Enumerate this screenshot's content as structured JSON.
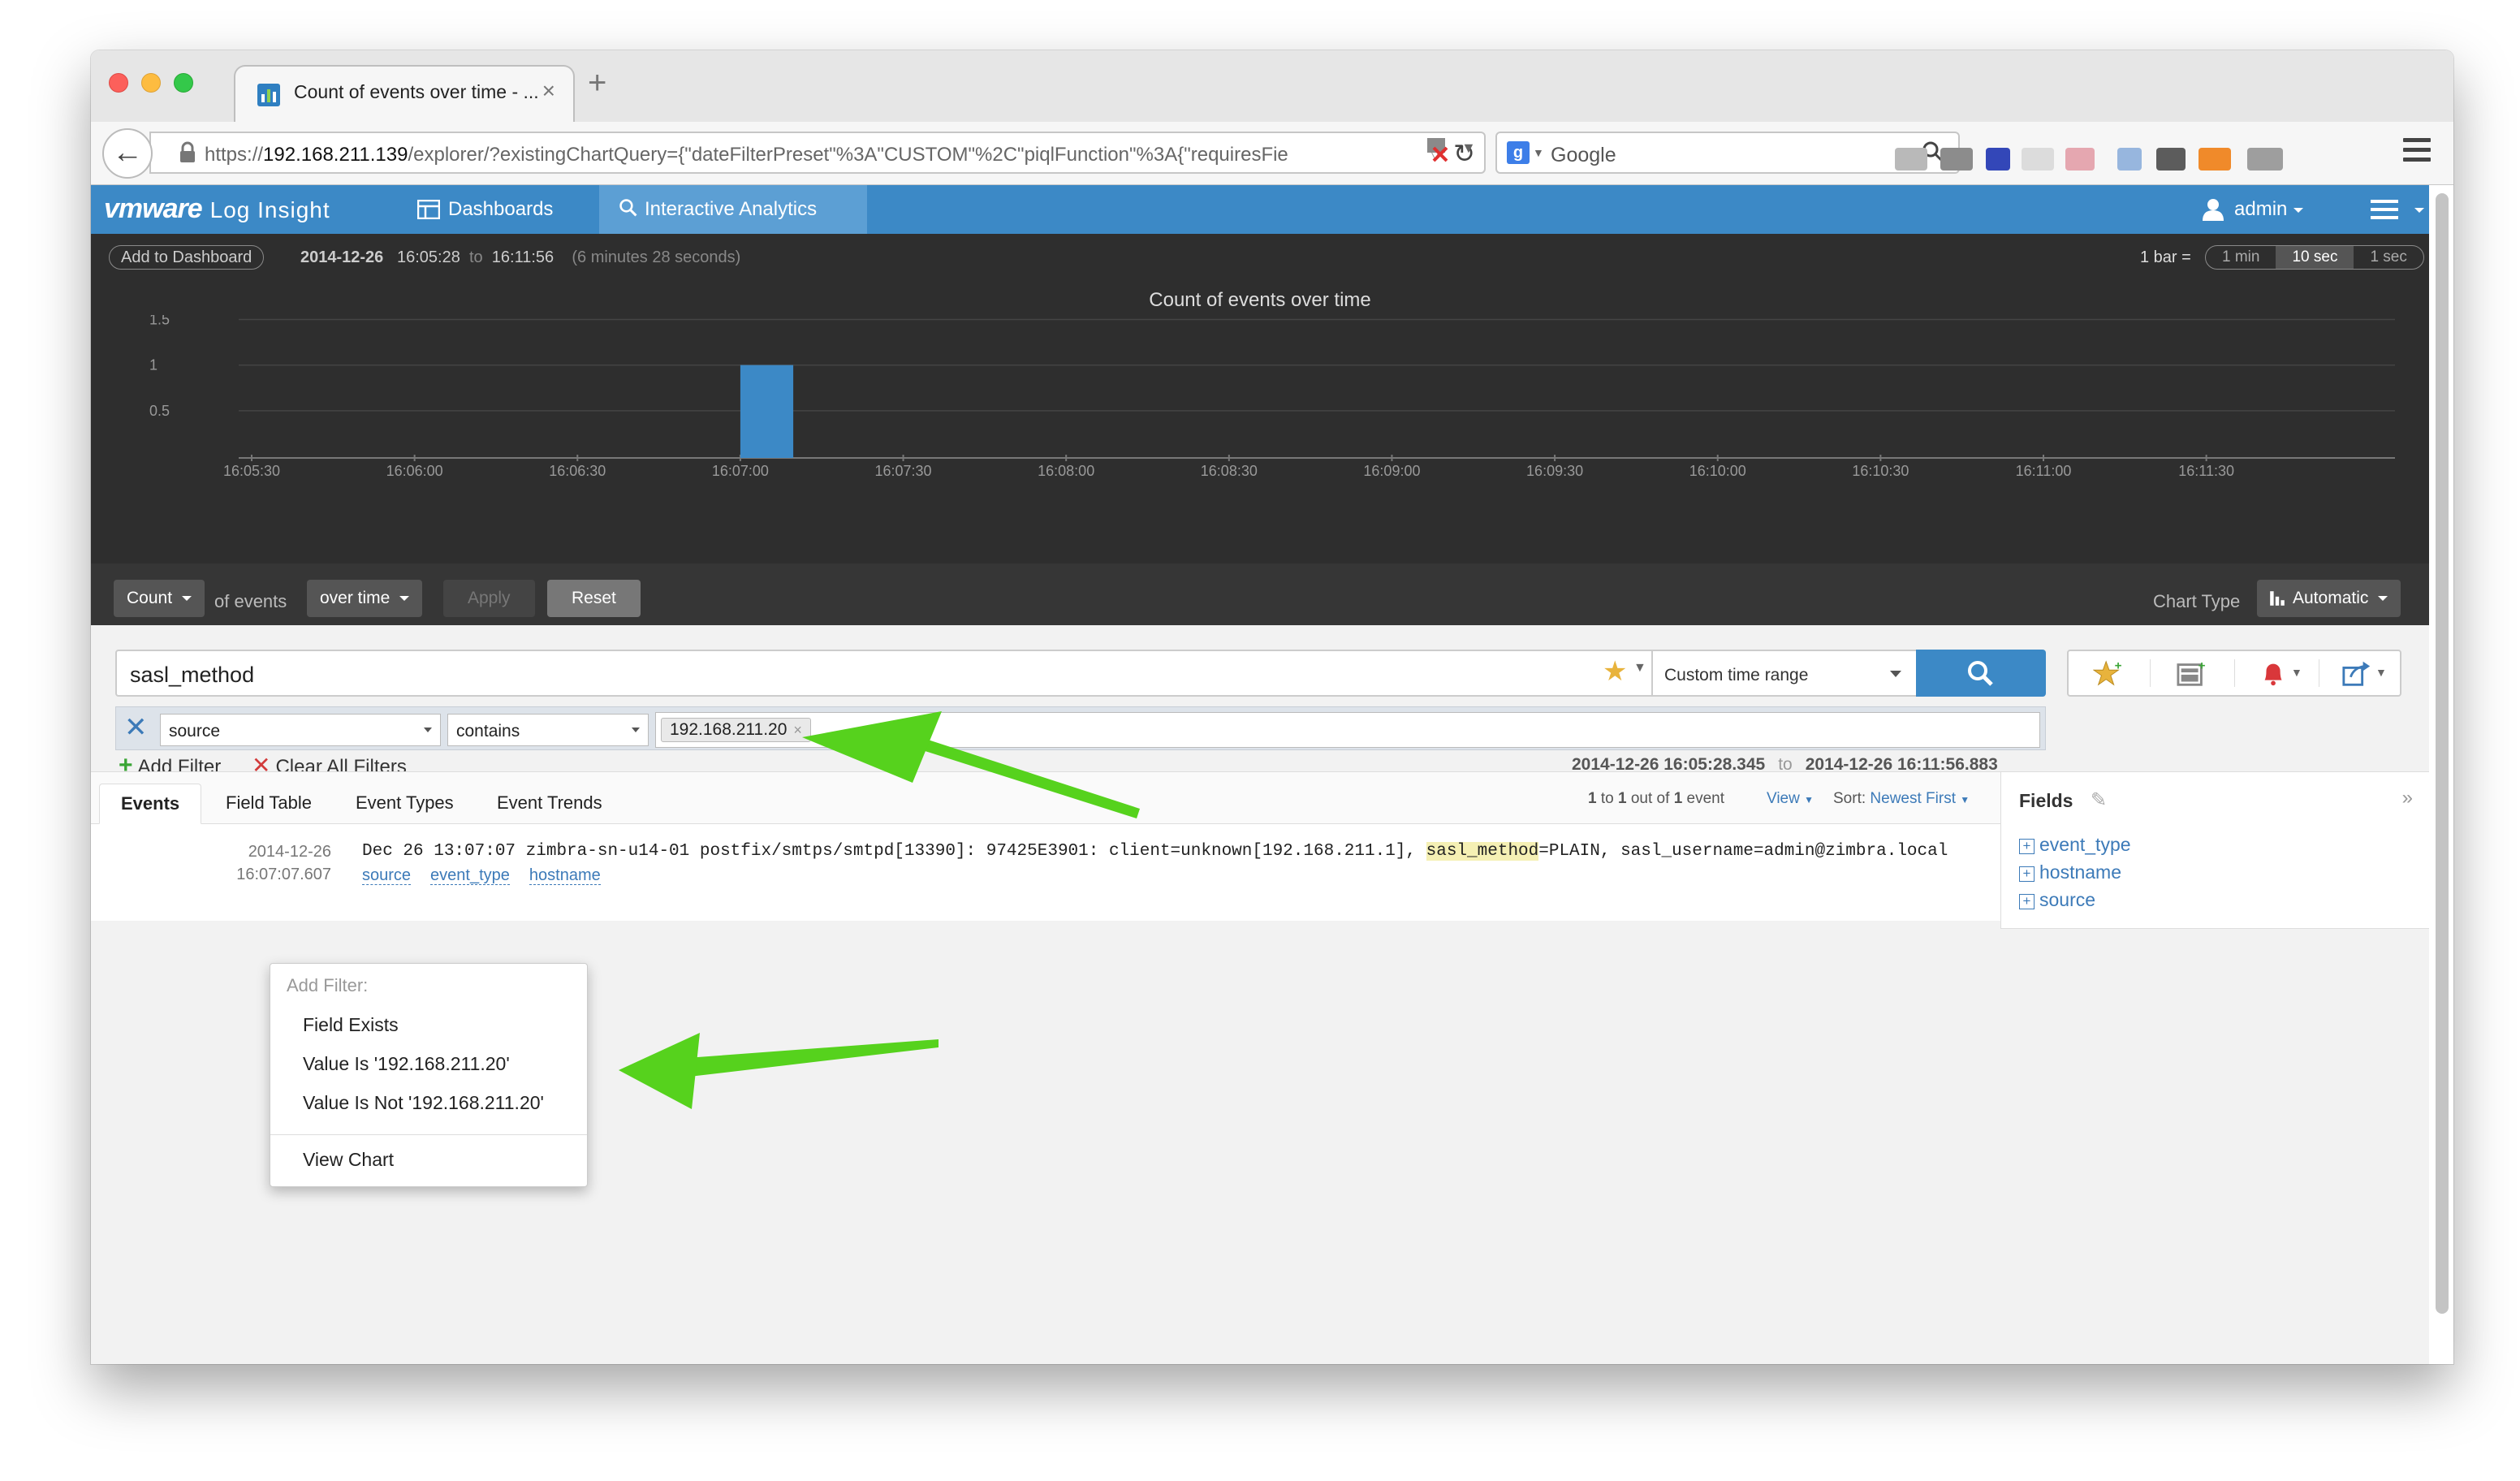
{
  "browser": {
    "tab_title": "Count of events over time - ...",
    "tab_close": "×",
    "new_tab": "+",
    "url_prefix": "https://",
    "url_host": "192.168.211.139",
    "url_rest": "/explorer/?existingChartQuery={\"dateFilterPreset\"%3A\"CUSTOM\"%2C\"piqlFunction\"%3A{\"requiresFie",
    "search_engine": "Google"
  },
  "app": {
    "logo_brand": "vmware",
    "logo_product": "Log Insight",
    "nav": [
      {
        "label": "Dashboards"
      },
      {
        "label": "Interactive Analytics"
      }
    ],
    "user": "admin"
  },
  "chart_header": {
    "add_to_dashboard": "Add to Dashboard",
    "range_date": "2014-12-26",
    "range_start": "16:05:28",
    "range_to": "to",
    "range_end": "16:11:56",
    "range_duration": "(6 minutes 28 seconds)",
    "bar_label": "1 bar =",
    "bar_options": [
      "1 min",
      "10 sec",
      "1 sec"
    ],
    "bar_active": "10 sec"
  },
  "chart_data": {
    "type": "bar",
    "title": "Count of events over time",
    "x_ticks": [
      "16:05:30",
      "16:06:00",
      "16:06:30",
      "16:07:00",
      "16:07:30",
      "16:08:00",
      "16:08:30",
      "16:09:00",
      "16:09:30",
      "16:10:00",
      "16:10:30",
      "16:11:00",
      "16:11:30"
    ],
    "y_ticks": [
      "0.5",
      "1",
      "1.5"
    ],
    "ylim": [
      0,
      1.5
    ],
    "bars": [
      {
        "x": "16:07:00",
        "value": 1
      }
    ],
    "bar_color": "#3c89c6",
    "grid": true
  },
  "chart_toolbar": {
    "function": "Count",
    "of_events": "of events",
    "group": "over time",
    "apply": "Apply",
    "reset": "Reset",
    "chart_type_label": "Chart Type",
    "chart_type": "Automatic"
  },
  "search": {
    "query": "sasl_method",
    "time_range": "Custom time range"
  },
  "filter": {
    "field": "source",
    "operator": "contains",
    "value": "192.168.211.20",
    "chip_remove": "×",
    "add_filter": "Add Filter",
    "clear_all": "Clear All Filters",
    "from": "2014-12-26 16:05:28.345",
    "to_word": "to",
    "to": "2014-12-26 16:11:56.883"
  },
  "results": {
    "tabs": [
      "Events",
      "Field Table",
      "Event Types",
      "Event Trends"
    ],
    "count_start": "1",
    "count_to": "to",
    "count_end": "1",
    "count_out_of": "out of",
    "count_total": "1",
    "count_unit": "event",
    "view": "View",
    "sort_label": "Sort:",
    "sort_value": "Newest First"
  },
  "event": {
    "date": "2014-12-26",
    "time": "16:07:07.607",
    "text_before": "Dec 26 13:07:07 zimbra-sn-u14-01 postfix/smtps/smtpd[13390]: 97425E3901: client=unknown[192.168.211.1], ",
    "text_highlight": "sasl_method",
    "text_after": "=PLAIN, sasl_username=admin@zimbra.local",
    "fields": [
      "source",
      "event_type",
      "hostname"
    ]
  },
  "fields_panel": {
    "title": "Fields",
    "items": [
      "event_type",
      "hostname",
      "source"
    ]
  },
  "popup": {
    "header": "Add Filter:",
    "items": [
      "Field Exists",
      "Value Is '192.168.211.20'",
      "Value Is Not '192.168.211.20'",
      "View Chart"
    ]
  },
  "colors": {
    "appbar": "#3c89c6",
    "nav_active": "#5c9fd4",
    "chart_bg": "#2e2e2e",
    "annotation_arrow": "#56d21d"
  }
}
